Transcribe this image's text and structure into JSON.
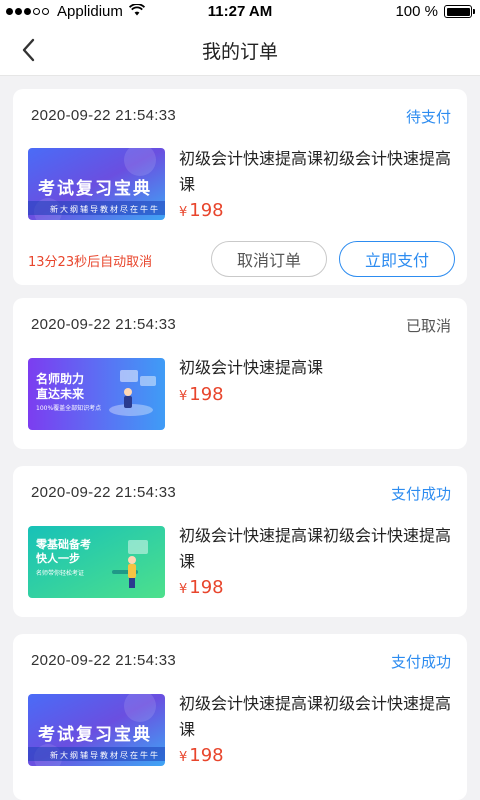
{
  "status_bar": {
    "carrier": "Applidium",
    "time": "11:27 AM",
    "battery": "100 %"
  },
  "nav": {
    "title": "我的订单"
  },
  "banners": {
    "exam": {
      "title": "考试复习宝典",
      "subtitle": "新大纲辅导教材尽在牛牛"
    },
    "teacher": {
      "title_line1": "名师助力",
      "title_line2": "直达未来",
      "tagline": "100%覆盖全部知识考点"
    },
    "basics": {
      "title_line1": "零基础备考",
      "title_line2": "快人一步",
      "tagline": "名师带你轻松考证"
    }
  },
  "orders": [
    {
      "date": "2020-09-22 21:54:33",
      "status": "待支付",
      "title": "初级会计快速提高课初级会计快速提高课",
      "currency": "¥",
      "price": "198",
      "countdown": "13分23秒后自动取消",
      "cancel_label": "取消订单",
      "pay_label": "立即支付"
    },
    {
      "date": "2020-09-22 21:54:33",
      "status": "已取消",
      "title": "初级会计快速提高课",
      "currency": "¥",
      "price": "198"
    },
    {
      "date": "2020-09-22 21:54:33",
      "status": "支付成功",
      "title": "初级会计快速提高课初级会计快速提高课",
      "currency": "¥",
      "price": "198"
    },
    {
      "date": "2020-09-22 21:54:33",
      "status": "支付成功",
      "title": "初级会计快速提高课初级会计快速提高课",
      "currency": "¥",
      "price": "198"
    }
  ],
  "colors": {
    "accent": "#2d8cf0",
    "price": "#e8452c",
    "background": "#f2f2f4"
  }
}
